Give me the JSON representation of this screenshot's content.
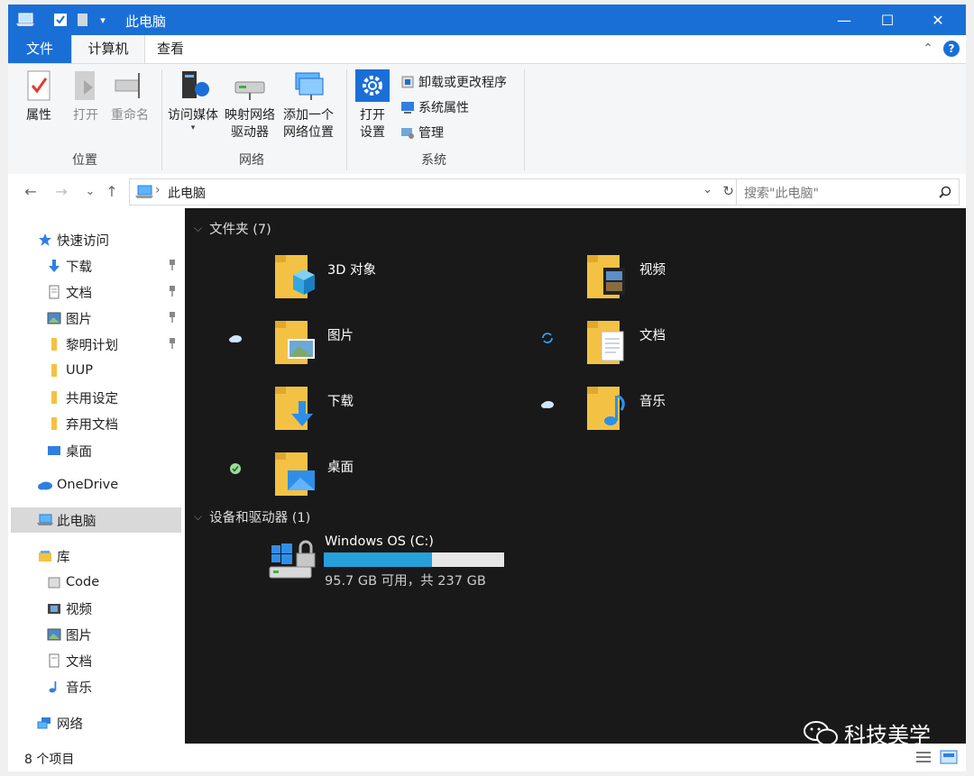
{
  "window": {
    "title": "此电脑",
    "quick_access_dropdown": "▾",
    "controls": {
      "minimize": "—",
      "maximize": "☐",
      "close": "✕"
    }
  },
  "ribbon": {
    "tabs": {
      "file": "文件",
      "computer": "计算机",
      "view": "查看"
    },
    "collapse_glyph": "⌃",
    "help_glyph": "?",
    "location_group": {
      "label": "位置",
      "properties": "属性",
      "open": "打开",
      "rename": "重命名"
    },
    "network_group": {
      "label": "网络",
      "access_media": "访问媒体",
      "map_drive_l1": "映射网络",
      "map_drive_l2": "驱动器",
      "add_location_l1": "添加一个",
      "add_location_l2": "网络位置"
    },
    "system_group": {
      "label": "系统",
      "open_settings_l1": "打开",
      "open_settings_l2": "设置",
      "uninstall": "卸载或更改程序",
      "system_properties": "系统属性",
      "manage": "管理"
    }
  },
  "address": {
    "back": "←",
    "forward": "→",
    "recent": "⌄",
    "up": "↑",
    "path": "此电脑",
    "path_sep": "›",
    "search_placeholder": "搜索\"此电脑\""
  },
  "navpane": {
    "quick_access": "快速访问",
    "downloads": "下载",
    "documents": "文档",
    "pictures": "图片",
    "plan": "黎明计划",
    "uup": "UUP",
    "shared_settings": "共用设定",
    "discarded_docs": "弃用文档",
    "desktop": "桌面",
    "onedrive": "OneDrive",
    "this_pc": "此电脑",
    "libraries": "库",
    "lib_code": "Code",
    "lib_videos": "视频",
    "lib_pictures": "图片",
    "lib_documents": "文档",
    "lib_music": "音乐",
    "network": "网络"
  },
  "content": {
    "folders_header": "文件夹 (7)",
    "folders": {
      "objects3d": "3D 对象",
      "videos": "视频",
      "pictures": "图片",
      "documents": "文档",
      "downloads": "下载",
      "music": "音乐",
      "desktop": "桌面"
    },
    "drives_header": "设备和驱动器 (1)",
    "drive": {
      "name": "Windows OS (C:)",
      "free_text": "95.7 GB 可用，共 237 GB",
      "used_fraction": 0.6
    }
  },
  "watermark": "科技美学",
  "status": {
    "item_count": "8 个项目"
  },
  "colors": {
    "accent": "#1a6fd6",
    "content_bg": "#191919",
    "drive_fill": "#26a0da"
  }
}
